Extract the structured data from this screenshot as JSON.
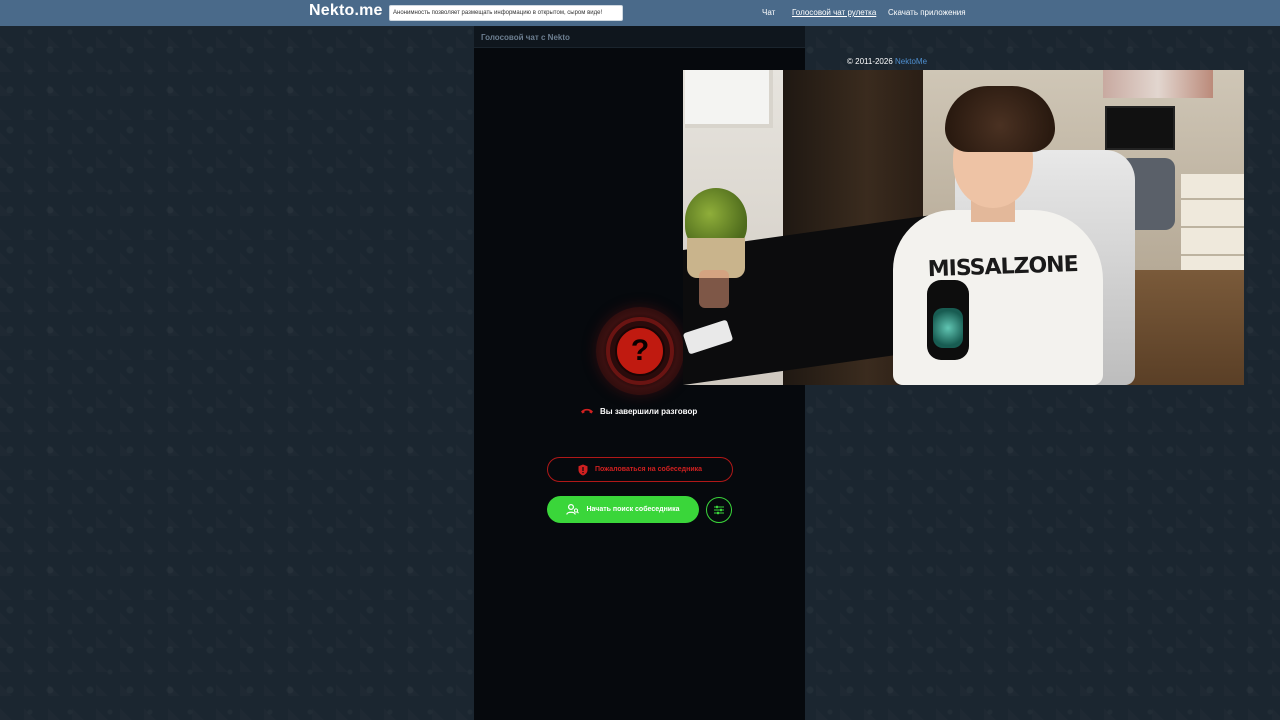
{
  "header": {
    "logo": "Nekto.me",
    "notice": "Анонимность позволяет размещать информацию в открытом, сыром виде!",
    "nav": [
      {
        "label": "Чат",
        "active": false
      },
      {
        "label": "Голосовой чат рулетка",
        "active": true
      },
      {
        "label": "Скачать приложения",
        "active": false
      }
    ]
  },
  "panel": {
    "title": "Голосовой чат с Nekto",
    "status_icon": "question-mark-icon",
    "status_symbol": "?",
    "status_text": "Вы завершили разговор",
    "report_button": "Пожаловаться на собеседника",
    "start_button": "Начать поиск собеседника"
  },
  "footer": {
    "copyright": "© 2011-2026",
    "brand_link": "NektoMe"
  },
  "video": {
    "shirt_print": "MISSALZONE"
  },
  "colors": {
    "header_bg": "#4a6a8a",
    "page_bg": "#1b2630",
    "panel_bg": "#06090d",
    "accent_green": "#3ad63a",
    "accent_red": "#c01a10",
    "link_blue": "#4f8fd0"
  }
}
